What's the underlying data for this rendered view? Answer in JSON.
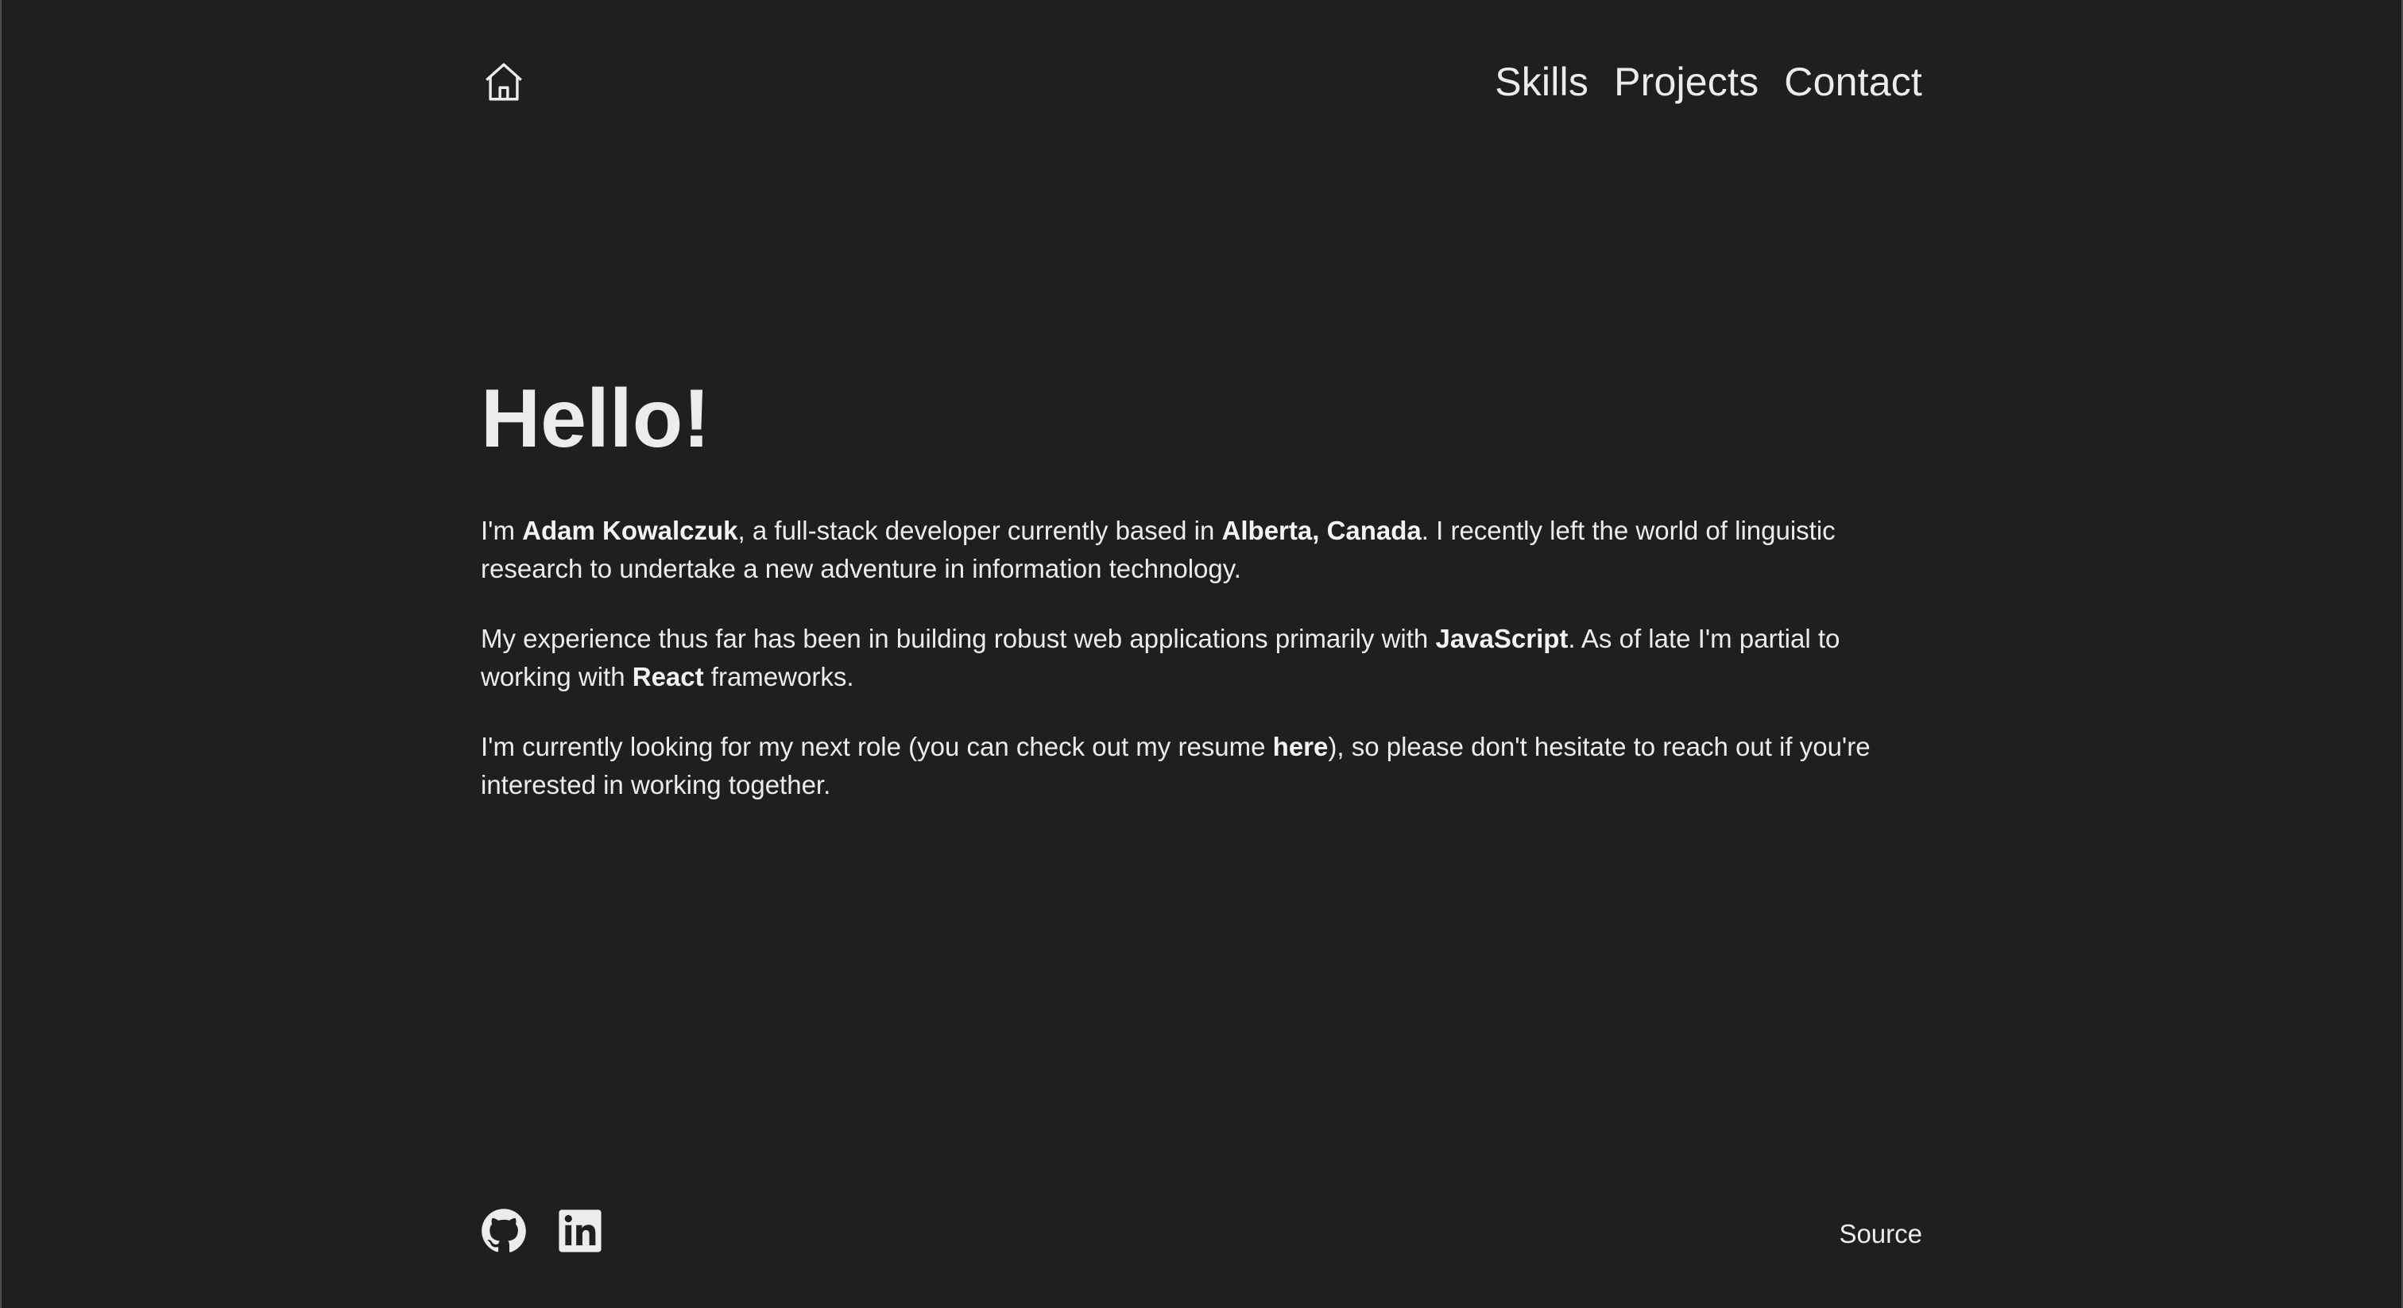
{
  "theme": {
    "background": "#1e1f21",
    "text": "#ececec"
  },
  "header": {
    "home_icon": "home-icon",
    "nav": [
      {
        "label": "Skills"
      },
      {
        "label": "Projects"
      },
      {
        "label": "Contact"
      }
    ]
  },
  "main": {
    "heading": "Hello!",
    "intro": {
      "t1": "I'm ",
      "name": "Adam Kowalczuk",
      "t2": ", a full-stack developer currently based in ",
      "location": "Alberta, Canada",
      "t3": ". I recently left the world of linguistic research to undertake a new adventure in information technology."
    },
    "experience": {
      "t1": "My experience thus far has been in building robust web applications primarily with ",
      "lang": "JavaScript",
      "t2": ". As of late I'm partial to working with ",
      "framework": "React",
      "t3": " frameworks."
    },
    "looking": {
      "t1": "I'm currently looking for my next role (you can check out my resume ",
      "link": "here",
      "t2": "), so please don't hesitate to reach out if you're interested in working together."
    }
  },
  "footer": {
    "icons": [
      "github-icon",
      "linkedin-icon"
    ],
    "source_label": "Source"
  }
}
